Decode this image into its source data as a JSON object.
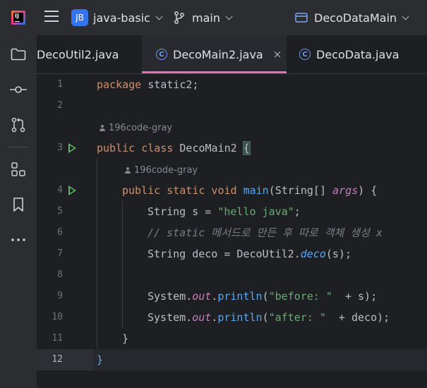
{
  "titlebar": {
    "project_badge": "JB",
    "project_name": "java-basic",
    "branch": "main",
    "run_config": "DecoDataMain"
  },
  "tabs": [
    {
      "label": "DecoUtil2.java",
      "active": false
    },
    {
      "label": "DecoMain2.java",
      "active": true,
      "close": "×"
    },
    {
      "label": "DecoData.java",
      "active": false
    }
  ],
  "tab_icon_letter": "C",
  "hints": {
    "author_class": "196code-gray",
    "author_method": "196code-gray"
  },
  "lines": {
    "l1": "1",
    "l2": "2",
    "l3": "3",
    "l4": "4",
    "l5": "5",
    "l6": "6",
    "l7": "7",
    "l8": "8",
    "l9": "9",
    "l10": "10",
    "l11": "11",
    "l12": "12"
  },
  "code": {
    "pkg_kw": "package",
    "pkg_name": " static2;",
    "class_kw": "public class",
    "class_name": " DecoMain2 ",
    "brace_open": "{",
    "method_kw": "public static void",
    "method_name": "main",
    "method_params_a": "(String[] ",
    "method_param_name": "args",
    "method_params_b": ") {",
    "l5_a": "String s = ",
    "l5_str": "\"hello java\"",
    "l5_b": ";",
    "l6_comment": "// static 메서드로 만든 후 따로 객체 생성 x",
    "l7_a": "String deco = DecoUtil2.",
    "l7_fn": "deco",
    "l7_b": "(s);",
    "l9_a": "System.",
    "l9_field": "out",
    "l9_dot": ".",
    "l9_fn": "println",
    "l9_p": "(",
    "l9_str": "\"before: \"",
    "l9_b": "  + s);",
    "l10_a": "System.",
    "l10_field": "out",
    "l10_dot": ".",
    "l10_fn": "println",
    "l10_p": "(",
    "l10_str": "\"after: \"",
    "l10_b": "  + deco);",
    "l11_brace": "}",
    "l12_brace": "}"
  },
  "colors": {
    "keyword": "#cf8e6d",
    "string": "#6aab73",
    "function": "#56a8f5",
    "field": "#c77dbb",
    "comment": "#7a7e85",
    "active_tab_underline": "#f06ab4",
    "run_icon": "#5fb865"
  }
}
